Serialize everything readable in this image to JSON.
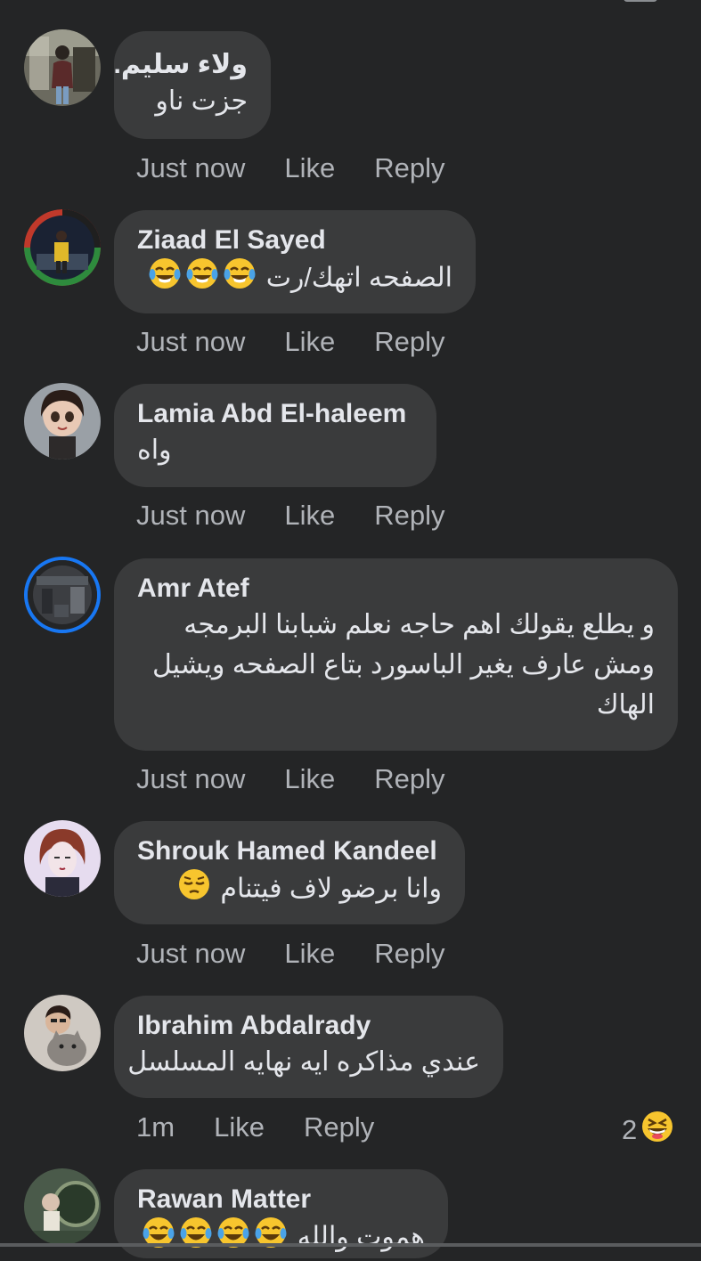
{
  "comments": [
    {
      "author": "ولاء سليم.",
      "text": "جزت ناو",
      "time": "Just now",
      "like": "Like",
      "reply": "Reply",
      "avatar_icon": "profile-photo-woman-room"
    },
    {
      "author": "Ziaad El Sayed",
      "text": "الصفحه اتهك/رت",
      "emoji": [
        "face-with-tears-of-joy",
        "face-with-tears-of-joy",
        "face-with-tears-of-joy"
      ],
      "time": "Just now",
      "like": "Like",
      "reply": "Reply",
      "avatar_icon": "profile-photo-man-standing"
    },
    {
      "author": "Lamia Abd El-haleem",
      "text": "واه",
      "time": "Just now",
      "like": "Like",
      "reply": "Reply",
      "avatar_icon": "profile-photo-doll"
    },
    {
      "author": "Amr Atef",
      "text_lines": [
        "و يطلع يقولك اهم حاجه نعلم شبابنا البرمجه",
        "ومش عارف يغير الباسورد بتاع الصفحه ويشيل",
        "الهاك"
      ],
      "time": "Just now",
      "like": "Like",
      "reply": "Reply",
      "avatar_icon": "profile-photo-room"
    },
    {
      "author": "Shrouk Hamed Kandeel",
      "text": "وانا برضو لاف فيتنام",
      "emoji": [
        "pensive-face"
      ],
      "time": "Just now",
      "like": "Like",
      "reply": "Reply",
      "avatar_icon": "profile-photo-cartoon-girl"
    },
    {
      "author": "Ibrahim Abdalrady",
      "text": "عندي مذاكره ايه نهايه المسلسل",
      "time": "1m",
      "like": "Like",
      "reply": "Reply",
      "reaction_count": "2",
      "reaction_icon": "grinning-squinting-face",
      "avatar_icon": "profile-photo-man-with-cat"
    },
    {
      "author": "Rawan Matter",
      "text": "هموت والله",
      "emoji": [
        "face-with-tears-of-joy",
        "face-with-tears-of-joy",
        "face-with-tears-of-joy",
        "face-with-tears-of-joy"
      ],
      "avatar_icon": "profile-photo-woman-mirror"
    }
  ],
  "colors": {
    "background": "#242526",
    "bubble": "#3a3b3c",
    "primary_text": "#e4e6eb",
    "secondary_text": "#b0b3b8",
    "active_story_ring": "#1877f2"
  }
}
